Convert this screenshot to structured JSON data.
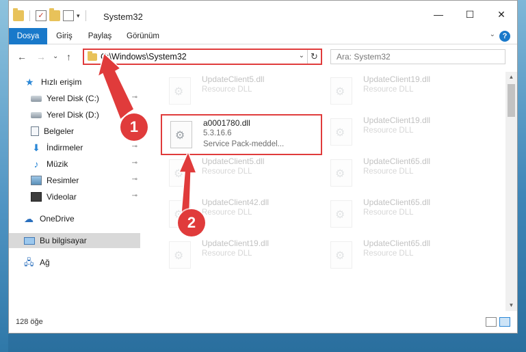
{
  "quick_access_toolbar": {
    "dropdown_glyph": "▾"
  },
  "window": {
    "title": "System32",
    "minimize": "—",
    "maximize": "☐",
    "close": "✕"
  },
  "ribbon": {
    "tabs": [
      {
        "label": "Dosya"
      },
      {
        "label": "Giriş"
      },
      {
        "label": "Paylaş"
      },
      {
        "label": "Görünüm"
      }
    ],
    "help_glyph": "?",
    "collapse_glyph": "⌄"
  },
  "nav": {
    "back": "←",
    "forward": "→",
    "recent": "⌄",
    "up": "↑",
    "address": "C:\\Windows\\System32",
    "address_dropdown": "⌄",
    "refresh": "↻",
    "search_placeholder": "Ara: System32"
  },
  "sidebar": {
    "items": [
      {
        "label": "Hızlı erişim",
        "icon": "star-icon"
      },
      {
        "label": "Yerel Disk (C:)",
        "icon": "disk-icon",
        "pinned": true
      },
      {
        "label": "Yerel Disk (D:)",
        "icon": "disk-icon"
      },
      {
        "label": "Belgeler",
        "icon": "document-icon"
      },
      {
        "label": "İndirmeler",
        "icon": "download-icon",
        "pinned": true
      },
      {
        "label": "Müzik",
        "icon": "music-icon",
        "pinned": true
      },
      {
        "label": "Resimler",
        "icon": "pictures-icon",
        "pinned": true
      },
      {
        "label": "Videolar",
        "icon": "video-icon",
        "pinned": true
      },
      {
        "label": "OneDrive",
        "icon": "cloud-icon"
      },
      {
        "label": "Bu bilgisayar",
        "icon": "computer-icon",
        "selected": true
      },
      {
        "label": "Ağ",
        "icon": "network-icon"
      }
    ],
    "pin_glyph": "📌"
  },
  "files": {
    "left_column": [
      {
        "name": "UpdateClient5.dll",
        "type": "Resource DLL"
      },
      {
        "name": "UpdateClient5.dll",
        "type": "Resource DLL"
      },
      {
        "name": "UpdateClient42.dll",
        "type": "Resource DLL"
      },
      {
        "name": "UpdateClient19.dll",
        "type": "Resource DLL"
      }
    ],
    "right_column": [
      {
        "name": "UpdateClient19.dll",
        "type": "Resource DLL"
      },
      {
        "name": "UpdateClient19.dll",
        "type": "Resource DLL"
      },
      {
        "name": "UpdateClient65.dll",
        "type": "Resource DLL"
      },
      {
        "name": "UpdateClient65.dll",
        "type": "Resource DLL"
      },
      {
        "name": "UpdateClient65.dll",
        "type": "Resource DLL"
      }
    ],
    "highlighted": {
      "name": "a0001780.dll",
      "version": "5.3.16.6",
      "description": "Service Pack-meddel..."
    }
  },
  "scrollbar": {
    "up": "▲",
    "down": "▼"
  },
  "status": {
    "item_count": "128 öğe"
  },
  "annotations": {
    "step1": "1",
    "step2": "2",
    "color": "#e03b3b"
  }
}
